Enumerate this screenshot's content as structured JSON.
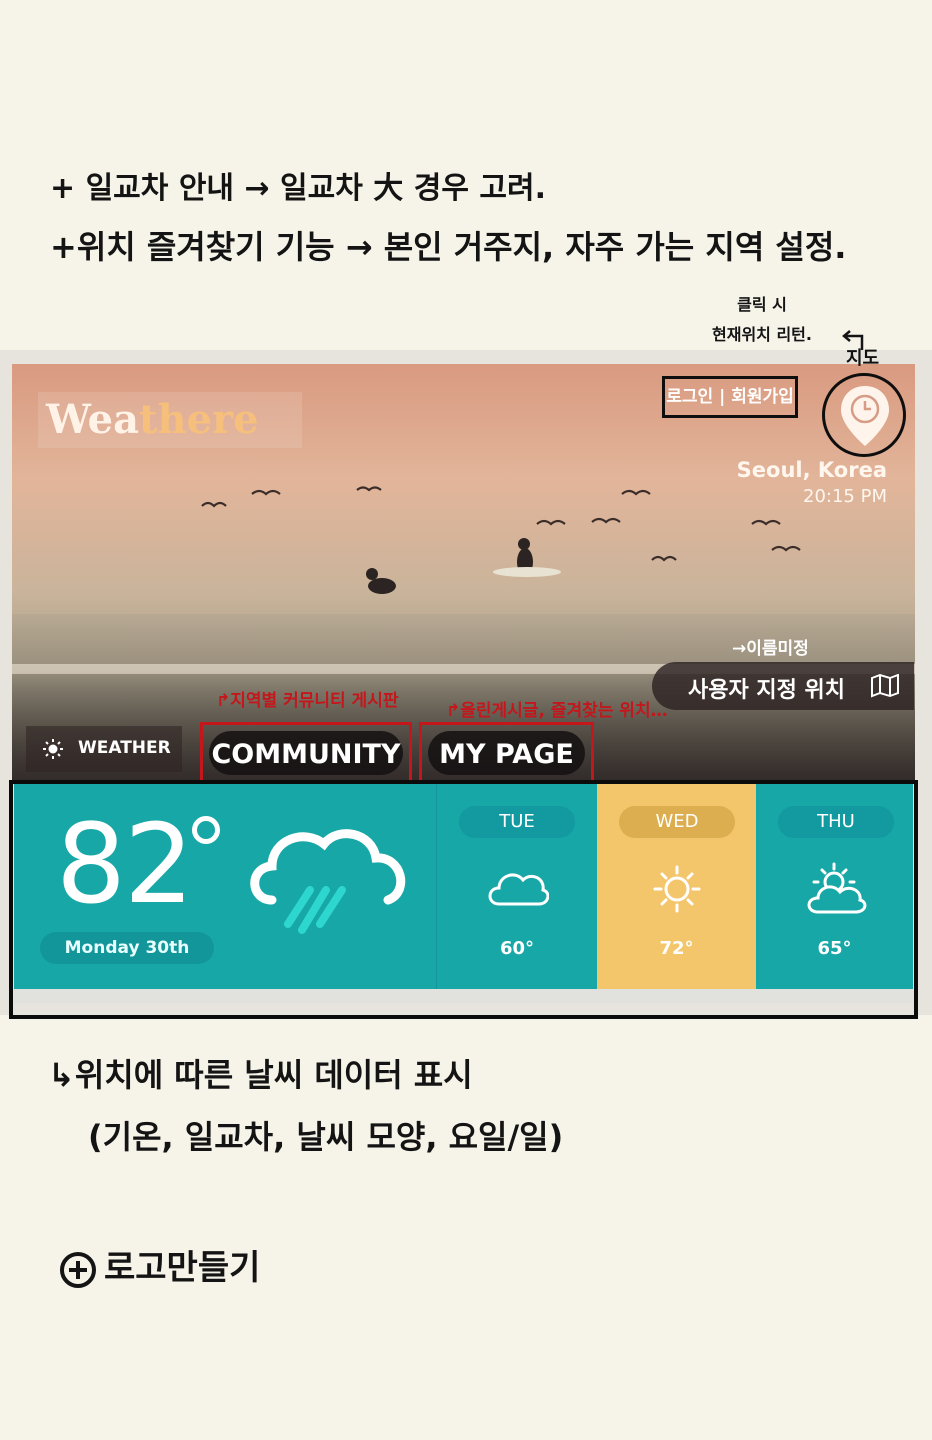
{
  "notes": {
    "top_line1": "+ 일교차 안내 → 일교차 大 경우 고려.",
    "top_line2": "+위치 즐겨찾기 기능 → 본인 거주지, 자주 가는 지역 설정.",
    "click_line1": "클릭 시",
    "click_line2": "현재위치 리턴.",
    "bottom_line1": "↳위치에 따른 날씨 데이터 표시",
    "bottom_line2": "(기온, 일교차, 날씨 모양, 요일/일)",
    "logo_task": "로고만들기"
  },
  "app": {
    "logo_part1": "Wea",
    "logo_part2": "there",
    "login_label": "로그인 | 회원가입",
    "city": "Seoul, Korea",
    "time": "20:15 PM",
    "name_note": "→이름미정",
    "user_location": "사용자 지정 위치",
    "map_label": "지도",
    "icons": [
      "location-pin-icon",
      "clock-icon",
      "map-icon",
      "sun-icon",
      "rain-cloud-icon",
      "cloud-icon",
      "partly-cloudy-icon"
    ]
  },
  "nav": {
    "weather": "WEATHER",
    "community": "COMMUNITY",
    "mypage": "MY PAGE",
    "community_note": "↱지역별 커뮤니티 게시판",
    "mypage_note": "↱올린게시글, 즐겨찾는 위치…"
  },
  "today": {
    "temp": "82",
    "date": "Monday 30th",
    "condition_icon": "rain-cloud-icon"
  },
  "forecast": [
    {
      "day": "TUE",
      "temp": "60°",
      "icon": "cloud-icon",
      "color": "#17a7a7"
    },
    {
      "day": "WED",
      "temp": "72°",
      "icon": "sun-icon",
      "color": "#f4c66c"
    },
    {
      "day": "THU",
      "temp": "65°",
      "icon": "partly-cloudy-icon",
      "color": "#17a7a7"
    }
  ],
  "colors": {
    "teal": "#17a7a7",
    "yellow": "#f4c66c",
    "annotation_red": "#c3171c"
  }
}
